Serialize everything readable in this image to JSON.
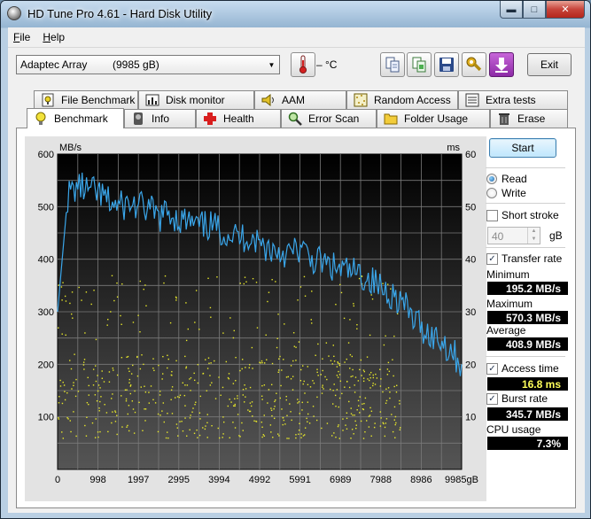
{
  "window": {
    "title": "HD Tune Pro 4.61 - Hard Disk Utility",
    "buttons": {
      "minimize": "▬",
      "maximize": "□",
      "close": "✕"
    }
  },
  "menu": [
    {
      "label": "File",
      "underline": "F",
      "rest": "ile"
    },
    {
      "label": "Help",
      "underline": "H",
      "rest": "elp"
    }
  ],
  "toolbar": {
    "drive_name": "Adaptec Array",
    "drive_size": "(9985 gB)",
    "temperature": "– °C",
    "exit_label": "Exit"
  },
  "tabs_top": [
    {
      "label": "File Benchmark",
      "icon": "file-benchmark-icon"
    },
    {
      "label": "Disk monitor",
      "icon": "disk-monitor-icon"
    },
    {
      "label": "AAM",
      "icon": "speaker-icon"
    },
    {
      "label": "Random Access",
      "icon": "random-access-icon"
    },
    {
      "label": "Extra tests",
      "icon": "extra-tests-icon"
    }
  ],
  "tabs_bottom": [
    {
      "label": "Benchmark",
      "icon": "lightbulb-icon",
      "active": true
    },
    {
      "label": "Info",
      "icon": "info-icon"
    },
    {
      "label": "Health",
      "icon": "health-cross-icon"
    },
    {
      "label": "Error Scan",
      "icon": "magnifier-icon"
    },
    {
      "label": "Folder Usage",
      "icon": "folder-icon"
    },
    {
      "label": "Erase",
      "icon": "trash-icon"
    }
  ],
  "panel": {
    "start_label": "Start",
    "read_label": "Read",
    "write_label": "Write",
    "read_selected": true,
    "short_stroke_label": "Short stroke",
    "short_stroke_checked": false,
    "short_stroke_value": "40",
    "short_stroke_unit": "gB",
    "transfer_rate_label": "Transfer rate",
    "transfer_rate_checked": true,
    "minimum_label": "Minimum",
    "minimum_value": "195.2 MB/s",
    "maximum_label": "Maximum",
    "maximum_value": "570.3 MB/s",
    "average_label": "Average",
    "average_value": "408.9 MB/s",
    "access_time_label": "Access time",
    "access_time_checked": true,
    "access_time_value": "16.8 ms",
    "burst_rate_label": "Burst rate",
    "burst_rate_checked": true,
    "burst_rate_value": "345.7 MB/s",
    "cpu_usage_label": "CPU usage",
    "cpu_usage_value": "7.3%"
  },
  "chart_data": {
    "type": "line",
    "left_unit": "MB/s",
    "right_unit": "ms",
    "x_unit": "gB",
    "left_ticks": [
      "600",
      "500",
      "400",
      "300",
      "200",
      "100"
    ],
    "right_ticks": [
      "60",
      "50",
      "40",
      "30",
      "20",
      "10"
    ],
    "x_ticks": [
      "0",
      "998",
      "1997",
      "2995",
      "3994",
      "4992",
      "5991",
      "6989",
      "7988",
      "8986",
      "9985gB"
    ],
    "xlim": [
      0,
      9985
    ],
    "ylim_left": [
      0,
      600
    ],
    "ylim_right": [
      0,
      60
    ],
    "colors": {
      "transfer": "#3aa6ea",
      "access": "#e9e92a",
      "background": "#222222",
      "grid": "#7a7a7a"
    },
    "series": [
      {
        "kind": "transfer_rate_line",
        "x": [
          0,
          250,
          500,
          750,
          1000,
          1250,
          1500,
          1750,
          2000,
          2250,
          2500,
          2750,
          3000,
          3250,
          3500,
          3750,
          4000,
          4250,
          4500,
          4750,
          5000,
          5250,
          5500,
          5750,
          6000,
          6250,
          6500,
          6750,
          7000,
          7250,
          7500,
          7750,
          8000,
          8250,
          8500,
          8750,
          9000,
          9250,
          9500,
          9750,
          9985
        ],
        "y": [
          300,
          520,
          540,
          530,
          525,
          510,
          500,
          505,
          500,
          495,
          480,
          490,
          475,
          470,
          460,
          465,
          455,
          450,
          440,
          445,
          430,
          420,
          415,
          410,
          420,
          400,
          395,
          385,
          380,
          375,
          370,
          360,
          345,
          335,
          320,
          290,
          270,
          255,
          245,
          225,
          200
        ]
      }
    ]
  }
}
